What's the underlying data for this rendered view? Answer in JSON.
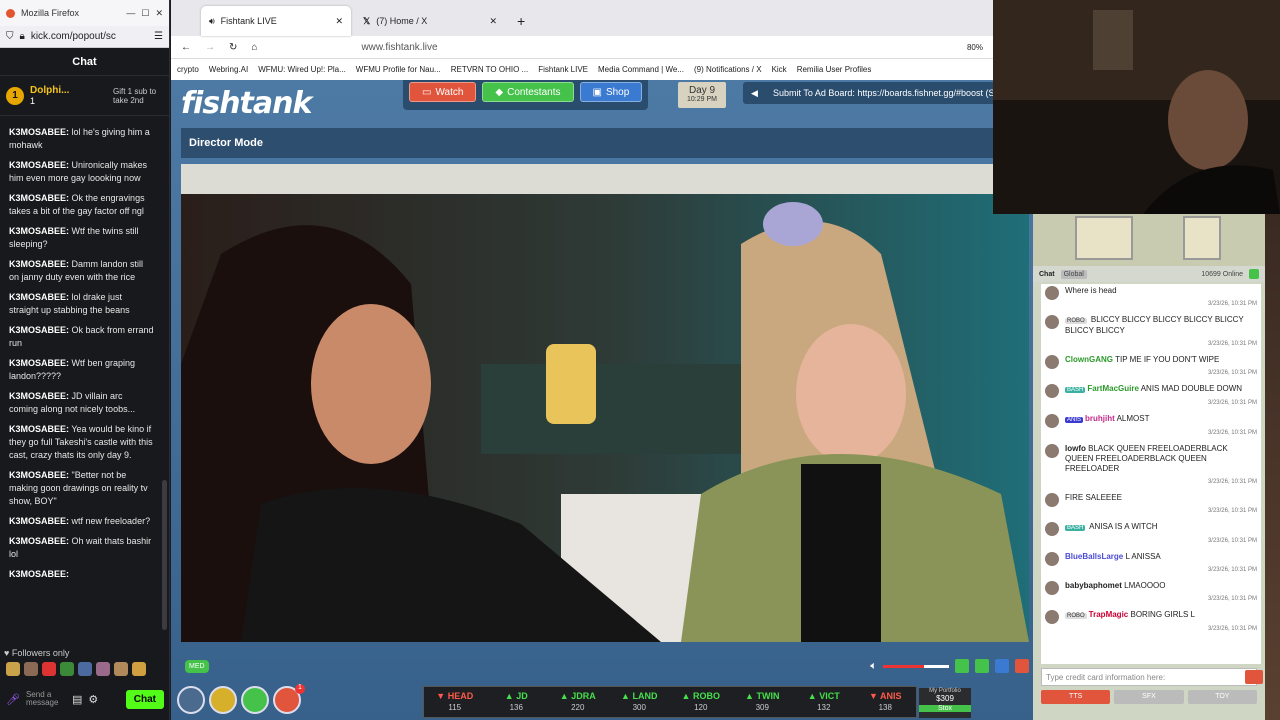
{
  "kick": {
    "window_title": "Mozilla Firefox",
    "url": "kick.com/popout/sc",
    "chat_title": "Chat",
    "pinned_user": "Dolphi...",
    "pinned_count": "1",
    "pinned_gift": "Gift 1 sub to take 2nd",
    "messages": [
      {
        "user": "K3MOSABEE:",
        "text": "lol he's giving him a mohawk"
      },
      {
        "user": "K3MOSABEE:",
        "text": "Unironically makes him even more gay loooking now"
      },
      {
        "user": "K3MOSABEE:",
        "text": "Ok the engravings takes a bit of the gay factor off ngl"
      },
      {
        "user": "K3MOSABEE:",
        "text": "Wtf the twins still sleeping?"
      },
      {
        "user": "K3MOSABEE:",
        "text": "Damm landon still on janny duty even with the rice"
      },
      {
        "user": "K3MOSABEE:",
        "text": "lol drake just straight up stabbing the beans"
      },
      {
        "user": "K3MOSABEE:",
        "text": "Ok back from errand run"
      },
      {
        "user": "K3MOSABEE:",
        "text": "Wtf ben graping landon?????"
      },
      {
        "user": "K3MOSABEE:",
        "text": "JD villain arc coming along not nicely toobs..."
      },
      {
        "user": "K3MOSABEE:",
        "text": "Yea would be kino if they go full Takeshi's castle with this cast, crazy thats its only day 9."
      },
      {
        "user": "K3MOSABEE:",
        "text": "\"Better not be making goon drawings on reality tv show, BOY\""
      },
      {
        "user": "K3MOSABEE:",
        "text": "wtf new freeloader?"
      },
      {
        "user": "K3MOSABEE:",
        "text": "Oh wait thats bashir lol"
      },
      {
        "user": "K3MOSABEE:",
        "text": ""
      }
    ],
    "followers_only": "Followers only",
    "send_placeholder": "Send a message",
    "chat_button": "Chat"
  },
  "firefox": {
    "tabs": [
      "Fishtank LIVE",
      "(7) Home / X"
    ],
    "url": "www.fishtank.live",
    "bookmarks": [
      "crypto",
      "Webring.AI",
      "WFMU: Wired Up!: Pla...",
      "WFMU Profile for Nau...",
      "RETVRN TO OHIO ...",
      "Fishtank LIVE",
      "Media Command | We...",
      "(9) Notifications / X",
      "Kick",
      "Remilia User Profiles"
    ],
    "zoom": "80%"
  },
  "site": {
    "logo": "fishtank",
    "buttons": [
      "Watch",
      "Contestants",
      "Shop"
    ],
    "day": "Day 9",
    "time": "10:29 PM",
    "ad_text": "Submit To Ad Board: https://boards.fishnet.gg/#boost (S",
    "director_mode": "Director Mode",
    "quality": "MED",
    "ticker": [
      {
        "name": "HEAD",
        "val": "115",
        "dir": "down"
      },
      {
        "name": "JD",
        "val": "136",
        "dir": "up"
      },
      {
        "name": "JDRA",
        "val": "220",
        "dir": "up"
      },
      {
        "name": "LAND",
        "val": "300",
        "dir": "up"
      },
      {
        "name": "ROBO",
        "val": "120",
        "dir": "up"
      },
      {
        "name": "TWIN",
        "val": "309",
        "dir": "up"
      },
      {
        "name": "VICT",
        "val": "132",
        "dir": "up"
      },
      {
        "name": "ANIS",
        "val": "138",
        "dir": "down"
      }
    ],
    "portfolio": "My Portfolio",
    "portfolio_val": "$309",
    "stox": "Stox",
    "notif_count": "1"
  },
  "rchat": {
    "tab_chat": "Chat",
    "tab_global": "Global",
    "online": "10699 Online",
    "messages": [
      {
        "user": "",
        "tag": "",
        "text": "Where is head",
        "ts": "3/23/26, 10:31 PM",
        "color": "#6b4bd6"
      },
      {
        "user": "",
        "tag": "ROBO",
        "text": "BLICCY BLICCY BLICCY BLICCY BLICCY BLICCY BLICCY",
        "ts": "3/23/26, 10:31 PM",
        "color": "#c03"
      },
      {
        "user": "ClownGANG",
        "tag": "",
        "text": "TIP ME IF YOU DON'T WIPE",
        "ts": "3/23/26, 10:31 PM",
        "color": "#2a9a2a"
      },
      {
        "user": "FartMacGuire",
        "tag": "BASH",
        "text": "ANIS MAD DOUBLE DOWN",
        "ts": "3/23/26, 10:31 PM",
        "color": "#2a9a2a"
      },
      {
        "user": "bruhjiht",
        "tag": "ANIS",
        "text": "ALMOST",
        "ts": "3/23/26, 10:31 PM",
        "color": "#c02a8a"
      },
      {
        "user": "lowfo",
        "tag": "",
        "text": "BLACK QUEEN FREELOADERBLACK QUEEN FREELOADERBLACK QUEEN FREELOADER",
        "ts": "3/23/26, 10:31 PM",
        "color": "#222"
      },
      {
        "user": "",
        "tag": "",
        "text": "FIRE SALEEEE",
        "ts": "3/23/26, 10:31 PM",
        "color": "#8a4bd6"
      },
      {
        "user": "",
        "tag": "BASH",
        "text": "ANISA IS A WITCH",
        "ts": "3/23/26, 10:31 PM",
        "color": "#d22"
      },
      {
        "user": "BlueBallsLarge",
        "tag": "",
        "text": "L ANISSA",
        "ts": "3/23/26, 10:31 PM",
        "color": "#4b4bd6"
      },
      {
        "user": "babybaphomet",
        "tag": "",
        "text": "LMAOOOO",
        "ts": "3/23/26, 10:31 PM",
        "color": "#222"
      },
      {
        "user": "TrapMagic",
        "tag": "ROBO",
        "text": "BORING GIRLS L",
        "ts": "3/23/26, 10:31 PM",
        "color": "#c03"
      }
    ],
    "input_placeholder": "Type credit card information here:",
    "buttons": [
      "TTS",
      "SFX",
      "TOY"
    ]
  }
}
